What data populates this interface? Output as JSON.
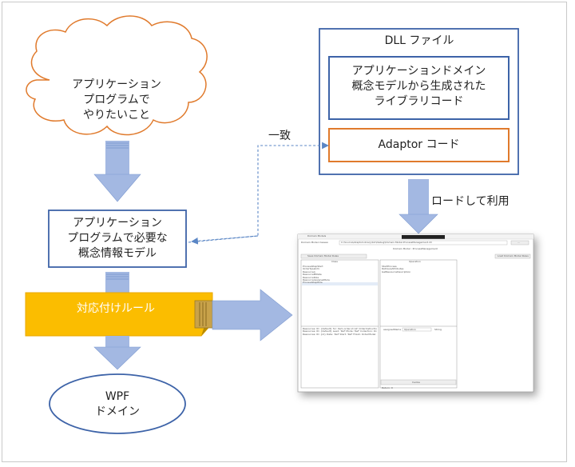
{
  "cloud": {
    "lines": [
      "アプリケーション",
      "プログラムで",
      "やりたいこと"
    ]
  },
  "concept_model": {
    "lines": [
      "アプリケーション",
      "プログラムで必要な",
      "概念情報モデル"
    ]
  },
  "mapping_rule": {
    "label": "対応付けルール"
  },
  "wpf": {
    "lines": [
      "WPF",
      "ドメイン"
    ]
  },
  "dll": {
    "title": "DLL ファイル",
    "domain_box": [
      "アプリケーションドメイン",
      "概念モデルから生成された",
      "ライブラリコード"
    ],
    "adaptor": "Adaptor コード"
  },
  "edges": {
    "match": "一致",
    "load": "ロードして利用"
  },
  "screenshot": {
    "title_bar": "Domain Models",
    "path_label": "Domain Model classes:",
    "path_value": "C:\\Source\\AdaptorLibrary\\bin\\Debug\\Domain.Model.ProcessManagement.dll",
    "browse_btn": "...",
    "domain_title": "Domain Model : ProcessManagement",
    "save_btn": "Save Domain Model Rules",
    "load_btn": "Load Domain Model Rules",
    "col_class": "Class",
    "col_operation": "Operation",
    "classes": [
      "ProcessStepStart",
      "OrderTypeInfo",
      "ResourceA",
      "ResourceBState",
      "ResourceRole",
      "ResourceAssignedRole",
      "ProcessStepRule"
    ],
    "operations": [
      "StartProcess",
      "RetrieveAttributes",
      "GetResourceDescription"
    ],
    "rules": [
      "Resources: ID: {default} for: item-order-id ref: OrderInstructions.OrderId",
      "Resources: ID: {default} Lead: 'Ref' Mode: 'Ref' Collection: OrderItem",
      "Resources: ID: {id} Date: 'Ref' Start: 'Ref' Finish: OrderModel"
    ],
    "param_label": "assignedName",
    "param_value": "Operation",
    "param_type": "String",
    "invoke_btn": "Invoke",
    "status": "Return: 0"
  }
}
